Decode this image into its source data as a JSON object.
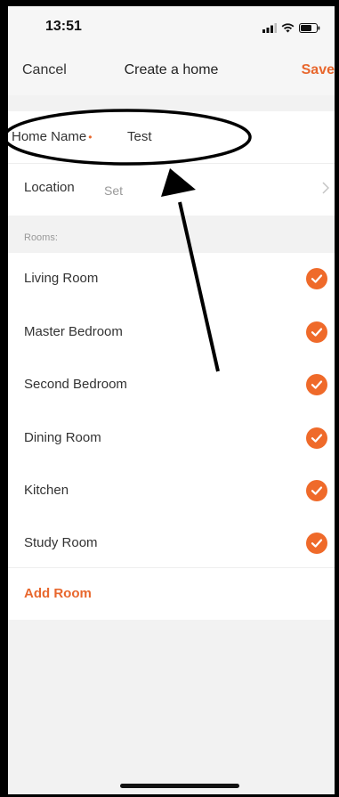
{
  "status_bar": {
    "time": "13:51",
    "icons": [
      "signal-icon",
      "wifi-icon",
      "battery-icon"
    ]
  },
  "nav": {
    "cancel_label": "Cancel",
    "title": "Create a home",
    "save_label": "Save"
  },
  "form": {
    "home_name_label": "Home Name",
    "required_marker": "•",
    "home_name_value": "Test",
    "location_label": "Location",
    "location_value": "Set"
  },
  "rooms": {
    "header": "Rooms:",
    "items": [
      {
        "label": "Living Room",
        "checked": true
      },
      {
        "label": "Master Bedroom",
        "checked": true
      },
      {
        "label": "Second Bedroom",
        "checked": true
      },
      {
        "label": "Dining Room",
        "checked": true
      },
      {
        "label": "Kitchen",
        "checked": true
      },
      {
        "label": "Study Room",
        "checked": true
      }
    ],
    "add_label": "Add Room"
  },
  "colors": {
    "accent": "#e8672d",
    "check": "#ef6a2a",
    "section_bg": "#f2f2f2",
    "annotation": "#000000"
  }
}
